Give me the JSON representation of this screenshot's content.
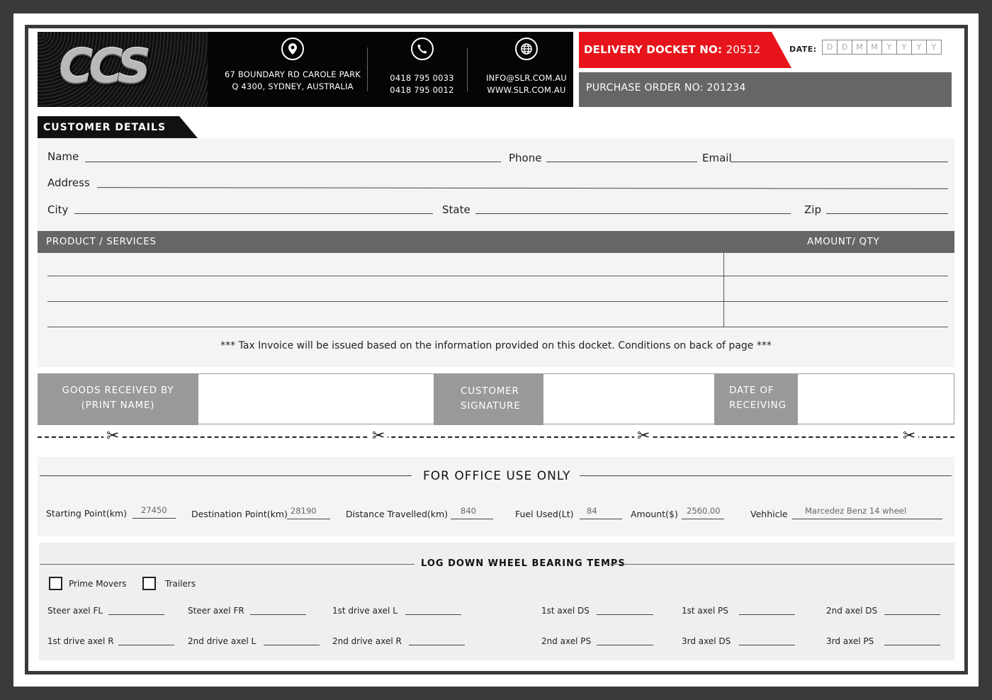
{
  "company": {
    "logo_text": "CCS",
    "address_line1": "67 BOUNDARY RD CAROLE PARK",
    "address_line2": "Q 4300, SYDNEY, AUSTRALIA",
    "phone1": "0418 795 0033",
    "phone2": "0418 795 0012",
    "email": "INFO@SLR.COM.AU",
    "website": "WWW.SLR.COM.AU",
    "icons": [
      "location-pin-icon",
      "phone-icon",
      "globe-icon"
    ]
  },
  "docket": {
    "label": "DELIVERY DOCKET NO:",
    "number": "20512",
    "date_label": "DATE:",
    "date_placeholders": [
      "D",
      "D",
      "M",
      "M",
      "Y",
      "Y",
      "Y",
      "Y"
    ],
    "po_label": "PURCHASE ORDER NO:",
    "po_number": "201234"
  },
  "customer": {
    "section_title": "CUSTOMER DETAILS",
    "name_label": "Name",
    "phone_label": "Phone",
    "email_label": "Email",
    "address_label": "Address",
    "city_label": "City",
    "state_label": "State",
    "zip_label": "Zip"
  },
  "products": {
    "col_product": "PRODUCT / SERVICES",
    "col_amount": "AMOUNT/ QTY",
    "note": "*** Tax Invoice will be issued based on the information provided on this docket. Conditions on back of page ***"
  },
  "signoff": {
    "received_by_line1": "GOODS RECEIVED BY",
    "received_by_line2": "(PRINT NAME)",
    "signature_line1": "CUSTOMER",
    "signature_line2": "SIGNATURE",
    "date_line1": "DATE OF",
    "date_line2": "RECEIVING"
  },
  "office": {
    "title": "FOR OFFICE USE ONLY",
    "fields": [
      {
        "label": "Starting Point(km)",
        "value": "27450"
      },
      {
        "label": "Destination Point(km)",
        "value": "28190"
      },
      {
        "label": "Distance Travelled(km)",
        "value": "840"
      },
      {
        "label": "Fuel Used(Lt)",
        "value": "84"
      },
      {
        "label": "Amount($)",
        "value": "2560.00"
      },
      {
        "label": "Vehhicle",
        "value": "Marcedez Benz 14 wheel"
      }
    ]
  },
  "wheel": {
    "title": "LOG DOWN WHEEL BEARING TEMPS",
    "options": [
      "Prime Movers",
      "Trailers"
    ],
    "row1": [
      "Steer axel FL",
      "Steer axel FR",
      "1st drive axel L",
      "1st axel DS",
      "1st axel PS",
      "2nd axel DS"
    ],
    "row2": [
      "1st drive axel R",
      "2nd drive axel L",
      "2nd drive axel R",
      "2nd axel PS",
      "3rd axel DS",
      "3rd axel PS"
    ]
  },
  "colors": {
    "accent_red": "#e8141b",
    "dark": "#050505",
    "grey_bar": "#666666",
    "grey_cell": "#999999"
  }
}
